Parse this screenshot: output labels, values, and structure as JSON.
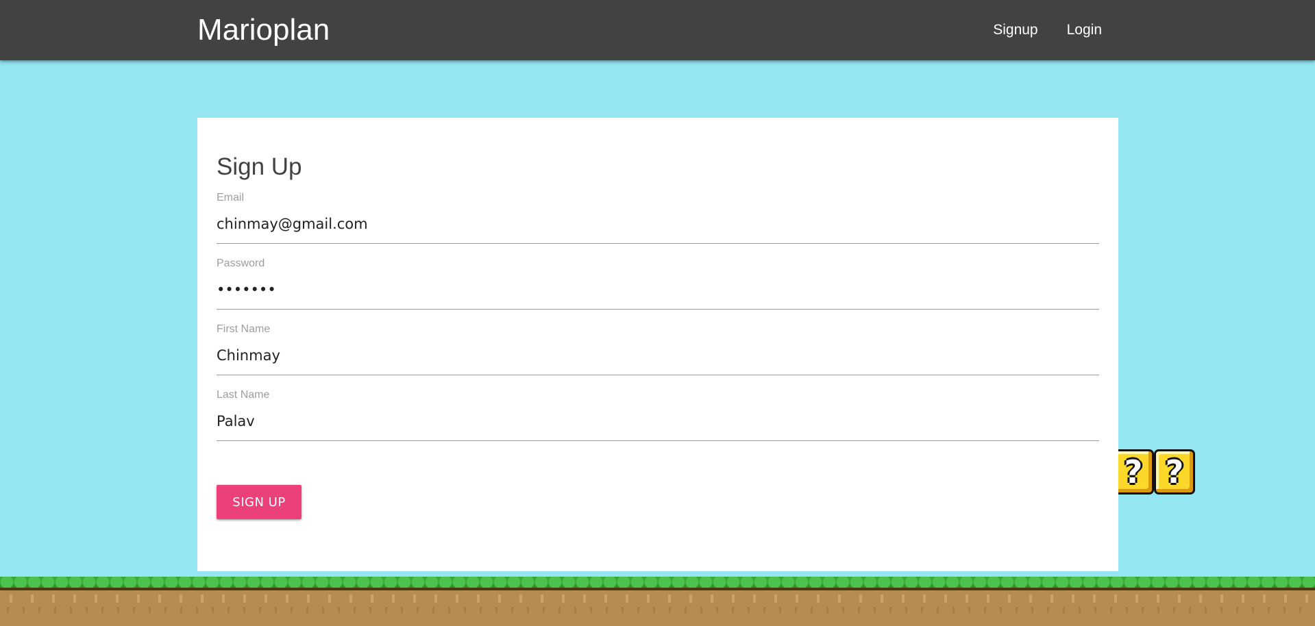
{
  "navbar": {
    "brand": "Marioplan",
    "links": [
      {
        "label": "Signup"
      },
      {
        "label": "Login"
      }
    ]
  },
  "form": {
    "title": "Sign Up",
    "fields": [
      {
        "label": "Email",
        "type": "email",
        "value": "chinmay@gmail.com"
      },
      {
        "label": "Password",
        "type": "password",
        "value": "chinmay"
      },
      {
        "label": "First Name",
        "type": "text",
        "value": "Chinmay"
      },
      {
        "label": "Last Name",
        "type": "text",
        "value": "Palav"
      }
    ],
    "submit_label": "SIGN UP"
  },
  "decor": {
    "question_block_symbol": "?",
    "question_block_count": 2
  },
  "colors": {
    "sky": "#95e6f3",
    "navbar": "#424242",
    "accent_button": "#ec407a",
    "grass": "#3aaa35",
    "dirt": "#b78c52",
    "question_block": "#fcd82a"
  }
}
